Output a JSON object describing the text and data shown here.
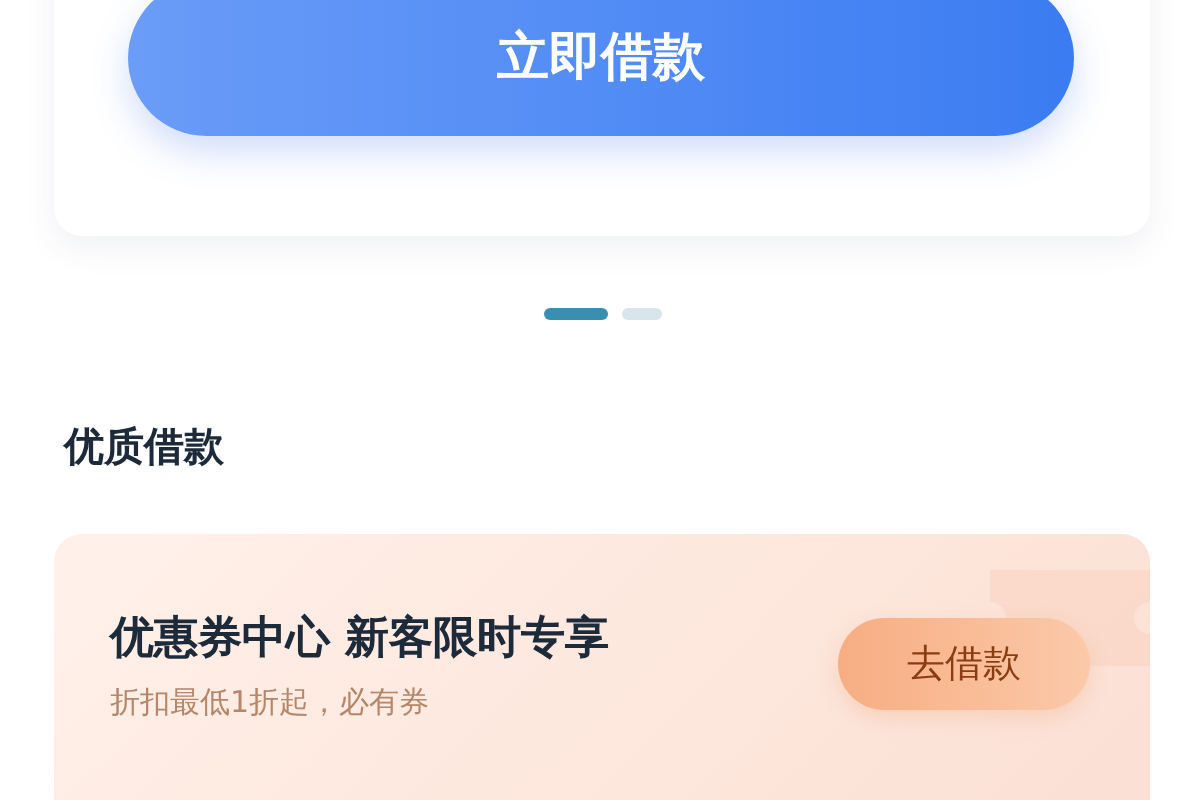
{
  "loan_card": {
    "button": "立即借款"
  },
  "pager": [
    {
      "selected": true
    },
    {
      "selected": false
    }
  ],
  "section": {
    "title": "优质借款"
  },
  "promo": {
    "title": "优惠券中心 新客限时专享",
    "subtitle": "折扣最低1折起，必有券",
    "button": "去借款"
  }
}
